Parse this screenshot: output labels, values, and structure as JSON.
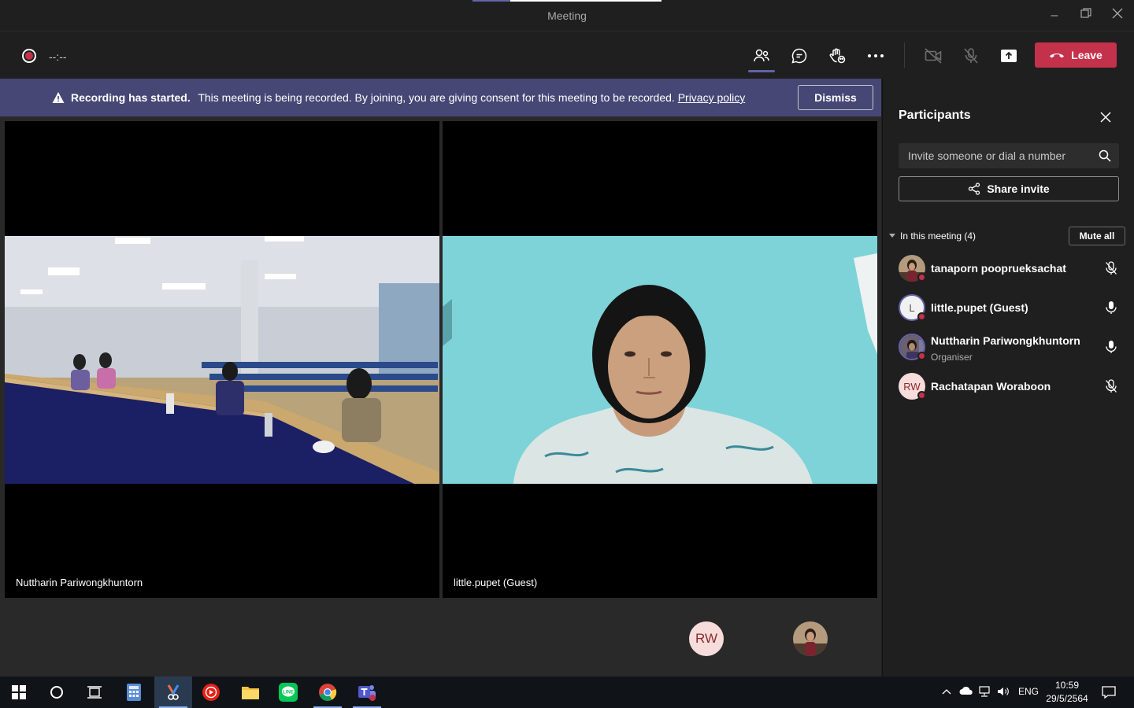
{
  "window": {
    "title": "Meeting"
  },
  "toolbar": {
    "timer": "--:--",
    "leave_label": "Leave"
  },
  "banner": {
    "bold": "Recording has started.",
    "message": "This meeting is being recorded. By joining, you are giving consent for this meeting to be recorded.",
    "link": "Privacy policy",
    "dismiss_label": "Dismiss"
  },
  "stage": {
    "tiles": [
      {
        "name": "Nuttharin Pariwongkhuntorn"
      },
      {
        "name": "little.pupet (Guest)"
      }
    ],
    "overflow": [
      {
        "initials": "RW"
      }
    ]
  },
  "panel": {
    "title": "Participants",
    "invite_placeholder": "Invite someone or dial a number",
    "share_label": "Share invite",
    "section_label": "In this meeting (4)",
    "mute_all_label": "Mute all",
    "participants": [
      {
        "name": "tanaporn pooprueksachat",
        "role": "",
        "mic": "muted"
      },
      {
        "name": "little.pupet (Guest)",
        "role": "",
        "initial": "L",
        "mic": "on"
      },
      {
        "name": "Nuttharin Pariwongkhuntorn",
        "role": "Organiser",
        "mic": "on"
      },
      {
        "name": "Rachatapan Woraboon",
        "role": "",
        "initials": "RW",
        "mic": "muted"
      }
    ]
  },
  "taskbar": {
    "language": "ENG",
    "time": "10:59",
    "date": "29/5/2564"
  },
  "colors": {
    "accent": "#6264a7",
    "leave": "#c4314b",
    "banner": "#464775"
  }
}
